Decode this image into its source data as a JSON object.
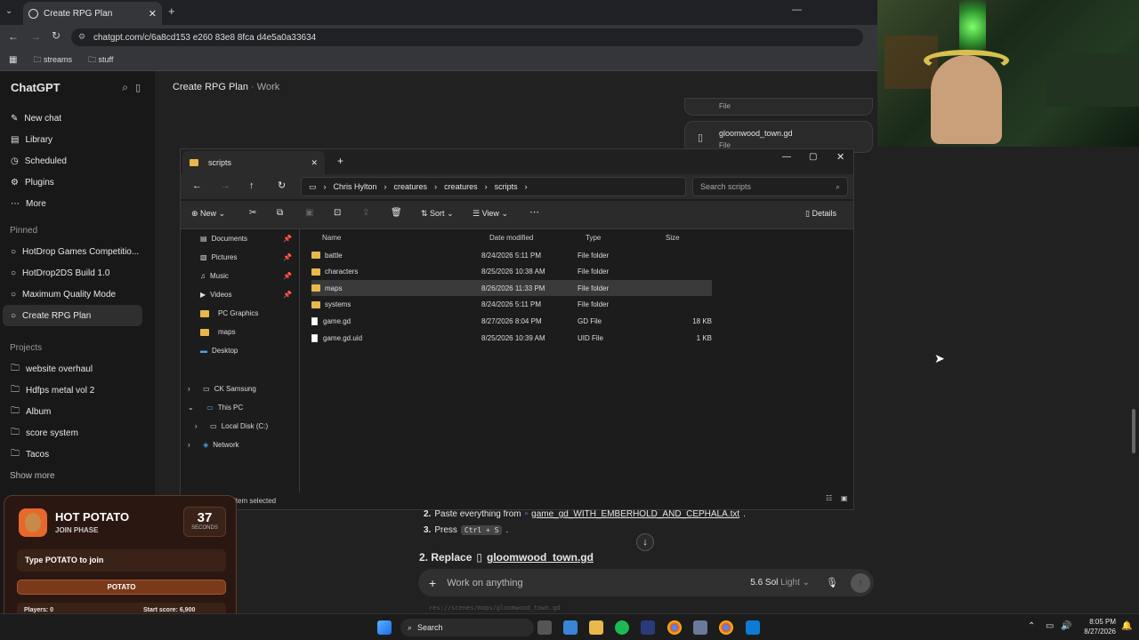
{
  "browser": {
    "tab_title": "Create RPG Plan",
    "url": "chatgpt.com/c/6a8cd153 e260 83e8 8fca d4e5a0a33634",
    "bookmarks": [
      "streams",
      "stuff"
    ]
  },
  "chatgpt": {
    "brand": "ChatGPT",
    "nav": [
      "New chat",
      "Library",
      "Scheduled",
      "Plugins",
      "More"
    ],
    "pinned_label": "Pinned",
    "pinned": [
      "HotDrop Games Competitio...",
      "HotDrop2DS Build 1.0",
      "Maximum Quality Mode",
      "Create RPG Plan"
    ],
    "projects_label": "Projects",
    "projects": [
      "website overhaul",
      "Hdfps metal vol 2",
      "Album",
      "score system",
      "Tacos"
    ],
    "show_more": "Show more",
    "convo_title": "Create RPG Plan",
    "convo_sep": "·",
    "convo_project": "Work",
    "file_card_1_type": "File",
    "file_card_2_name": "gloomwood_town.gd",
    "file_card_2_type": "File",
    "step2_text": "Paste everything from",
    "step2_file": "game_gd_WITH_EMBERHOLD_AND_CEPHALA.txt",
    "step2_end": ".",
    "step3_text": "Press",
    "step3_key": "Ctrl + S",
    "step3_end": ".",
    "section2": "2. Replace",
    "section2_file": "gloomwood_town.gd",
    "composer_placeholder": "Work on anything",
    "model": "5.6 Sol",
    "model_mode": "Light",
    "code_peek": "res://scenes/maps/gloomwood_town.gd",
    "list_num_2": "2.",
    "list_num_3": "3."
  },
  "explorer": {
    "tab_title": "scripts",
    "breadcrumb": [
      "Chris Hylton",
      "creatures",
      "creatures",
      "scripts"
    ],
    "search_placeholder": "Search scripts",
    "toolbar": {
      "new": "New",
      "sort": "Sort",
      "view": "View",
      "details": "Details"
    },
    "nav_quick": [
      "Documents",
      "Pictures",
      "Music",
      "Videos",
      "PC Graphics",
      "maps",
      "Desktop"
    ],
    "nav_tree": [
      "CK Samsung",
      "This PC",
      "Local Disk (C:)",
      "Network"
    ],
    "columns": [
      "Name",
      "Date modified",
      "Type",
      "Size"
    ],
    "rows": [
      {
        "name": "battle",
        "date": "8/24/2026 5:11 PM",
        "type": "File folder",
        "size": "",
        "kind": "folder"
      },
      {
        "name": "characters",
        "date": "8/25/2026 10:38 AM",
        "type": "File folder",
        "size": "",
        "kind": "folder"
      },
      {
        "name": "maps",
        "date": "8/26/2026 11:33 PM",
        "type": "File folder",
        "size": "",
        "kind": "folder"
      },
      {
        "name": "systems",
        "date": "8/24/2026 5:11 PM",
        "type": "File folder",
        "size": "",
        "kind": "folder"
      },
      {
        "name": "game.gd",
        "date": "8/27/2026 8:04 PM",
        "type": "GD File",
        "size": "18 KB",
        "kind": "file"
      },
      {
        "name": "game.gd.uid",
        "date": "8/25/2026 10:39 AM",
        "type": "UID File",
        "size": "1 KB",
        "kind": "file"
      }
    ],
    "status": "item selected"
  },
  "potato": {
    "title": "HOT POTATO",
    "phase": "JOIN PHASE",
    "seconds": "37",
    "seconds_label": "SECONDS",
    "prompt": "Type POTATO to join",
    "button": "POTATO",
    "players": "Players: 0",
    "start_score": "Start score: 6,900",
    "progress_fraction": 0.83
  },
  "taskbar": {
    "search": "Search",
    "time": "8:05 PM",
    "date": "8/27/2026"
  },
  "colors": {
    "accent_orange": "#e8682a",
    "folder": "#e8b84a"
  }
}
